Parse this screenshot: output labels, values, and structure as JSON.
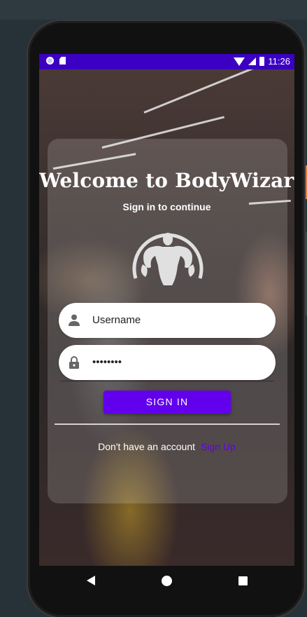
{
  "status_bar": {
    "time": "11:26",
    "left_icons": [
      "record-icon",
      "sd-card-icon"
    ],
    "right_icons": [
      "wifi-icon",
      "signal-icon",
      "battery-icon"
    ],
    "color": "#3b00c2"
  },
  "login": {
    "title": "Welcome to BodyWizard",
    "subtitle": "Sign in to continue",
    "logo_icon": "bodybuilder-logo-icon",
    "username": {
      "placeholder": "Username",
      "icon": "person-icon"
    },
    "password": {
      "value": "••••••••",
      "icon": "lock-icon"
    },
    "signin_label": "SIGN IN",
    "signup_prompt": "Don't have an account",
    "signup_link": "Sign Up",
    "accent_color": "#6200ee"
  },
  "nav_bar": {
    "icons": [
      "back-icon",
      "home-icon",
      "recents-icon"
    ]
  }
}
